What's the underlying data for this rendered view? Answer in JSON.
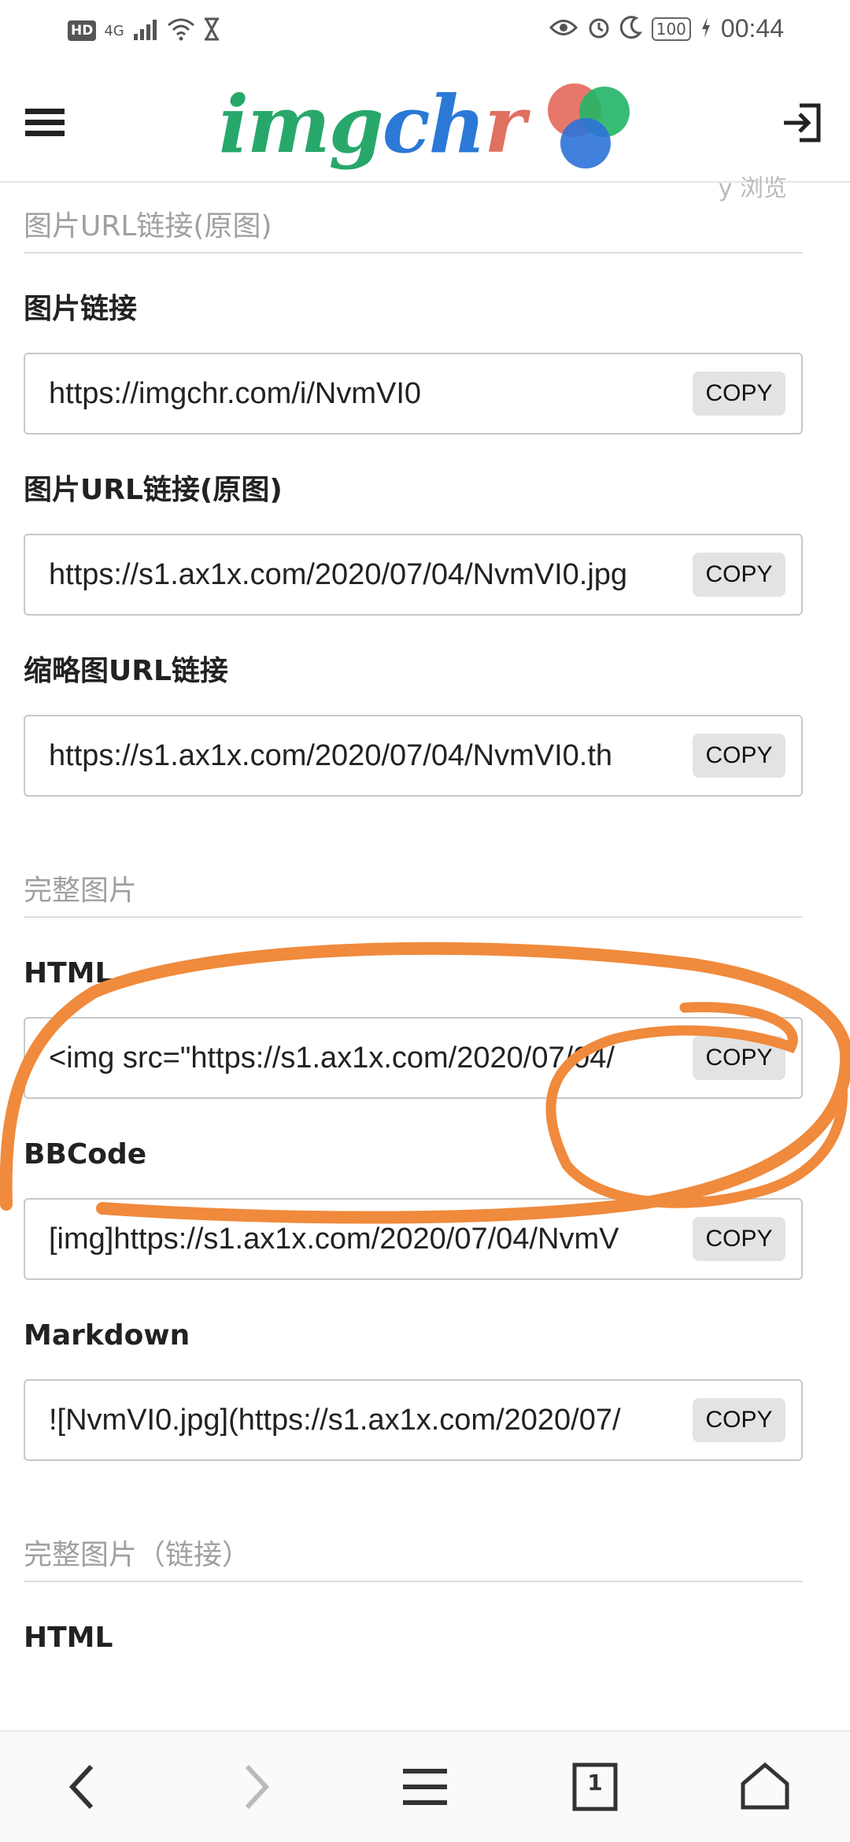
{
  "status_bar": {
    "left": {
      "hd": "HD",
      "network": "4G"
    },
    "right": {
      "battery": "100",
      "time": "00:44"
    }
  },
  "header": {
    "logo_text": {
      "part1": "img",
      "part2": "ch",
      "part3": "r"
    },
    "icons": {
      "menu": "hamburger-menu-icon",
      "login": "login-icon"
    }
  },
  "partial_top_text": "y 浏览",
  "sections": [
    {
      "title": "图片URL链接(原图)",
      "fields": [
        {
          "label": "图片链接",
          "value": "https://imgchr.com/i/NvmVI0",
          "copy": "COPY"
        },
        {
          "label": "图片URL链接(原图)",
          "value": "https://s1.ax1x.com/2020/07/04/NvmVI0.jpg",
          "copy": "COPY"
        },
        {
          "label": "缩略图URL链接",
          "value": "https://s1.ax1x.com/2020/07/04/NvmVI0.th",
          "copy": "COPY"
        }
      ]
    },
    {
      "title": "完整图片",
      "fields": [
        {
          "label": "HTML",
          "value": "<img src=\"https://s1.ax1x.com/2020/07/04/",
          "copy": "COPY"
        },
        {
          "label": "BBCode",
          "value": "[img]https://s1.ax1x.com/2020/07/04/NvmV",
          "copy": "COPY"
        },
        {
          "label": "Markdown",
          "value": "![NvmVI0.jpg](https://s1.ax1x.com/2020/07/",
          "copy": "COPY"
        }
      ]
    },
    {
      "title": "完整图片（链接）",
      "fields": [
        {
          "label": "HTML"
        }
      ]
    }
  ],
  "annotation": {
    "color": "#f08a3c"
  },
  "bottom_nav": {
    "icons": [
      "back-arrow-icon",
      "forward-arrow-icon",
      "menu-lines-icon",
      "tabs-icon",
      "home-icon"
    ],
    "tab_count": "1"
  }
}
